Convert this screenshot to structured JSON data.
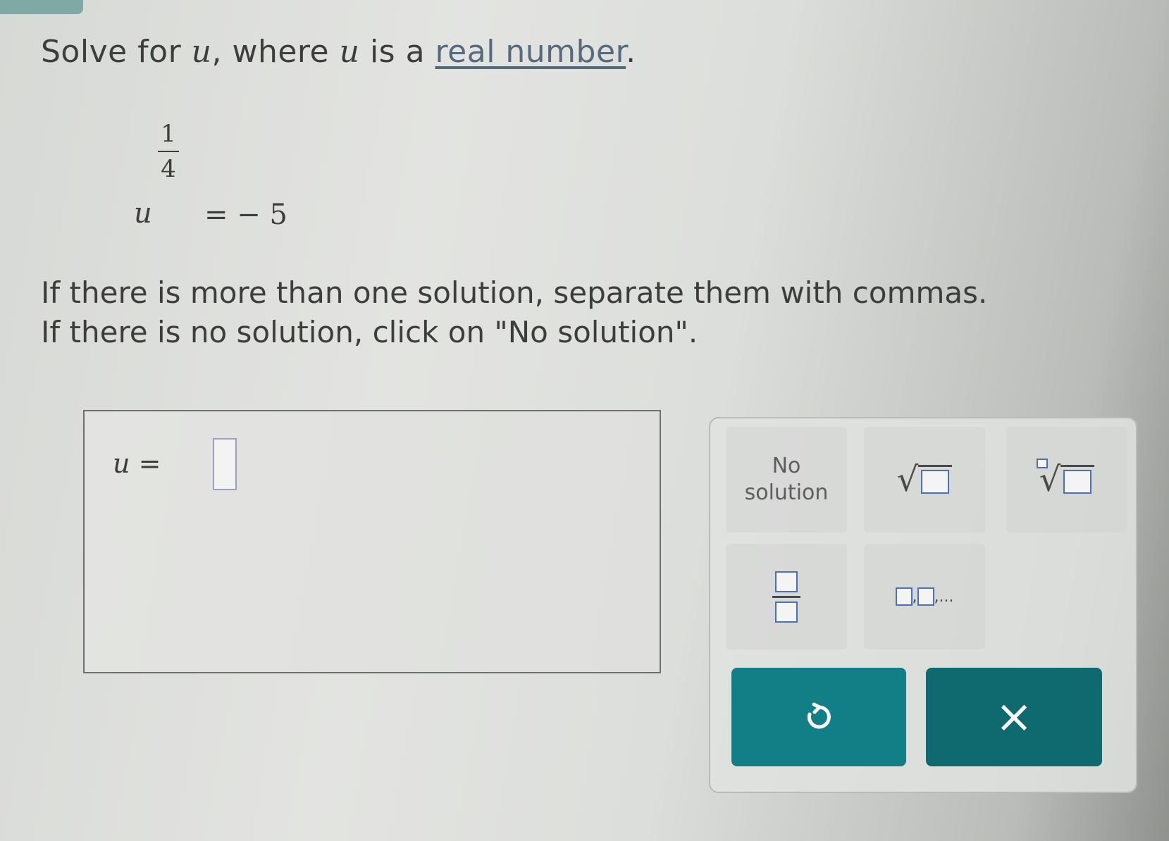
{
  "prompt": {
    "text_before": "Solve for ",
    "var1": "u",
    "text_middle": ", where ",
    "var2": "u",
    "text_after": " is a ",
    "link_text": "real number",
    "end": "."
  },
  "equation": {
    "base": "u",
    "exp_numerator": "1",
    "exp_denominator": "4",
    "rhs": "= − 5"
  },
  "instructions": {
    "line1": "If there is more than one solution, separate them with commas.",
    "line2": "If there is no solution, click on \"No solution\"."
  },
  "answer": {
    "variable": "u",
    "equals": " = ",
    "value": ""
  },
  "keypad": {
    "no_solution_line1": "No",
    "no_solution_line2": "solution",
    "list_suffix": ",..."
  },
  "colors": {
    "button_teal": "#127f86",
    "box_blue": "#4b70b8",
    "link": "#556b7d"
  },
  "icons": {
    "undo": "undo-icon",
    "clear": "close-icon"
  }
}
